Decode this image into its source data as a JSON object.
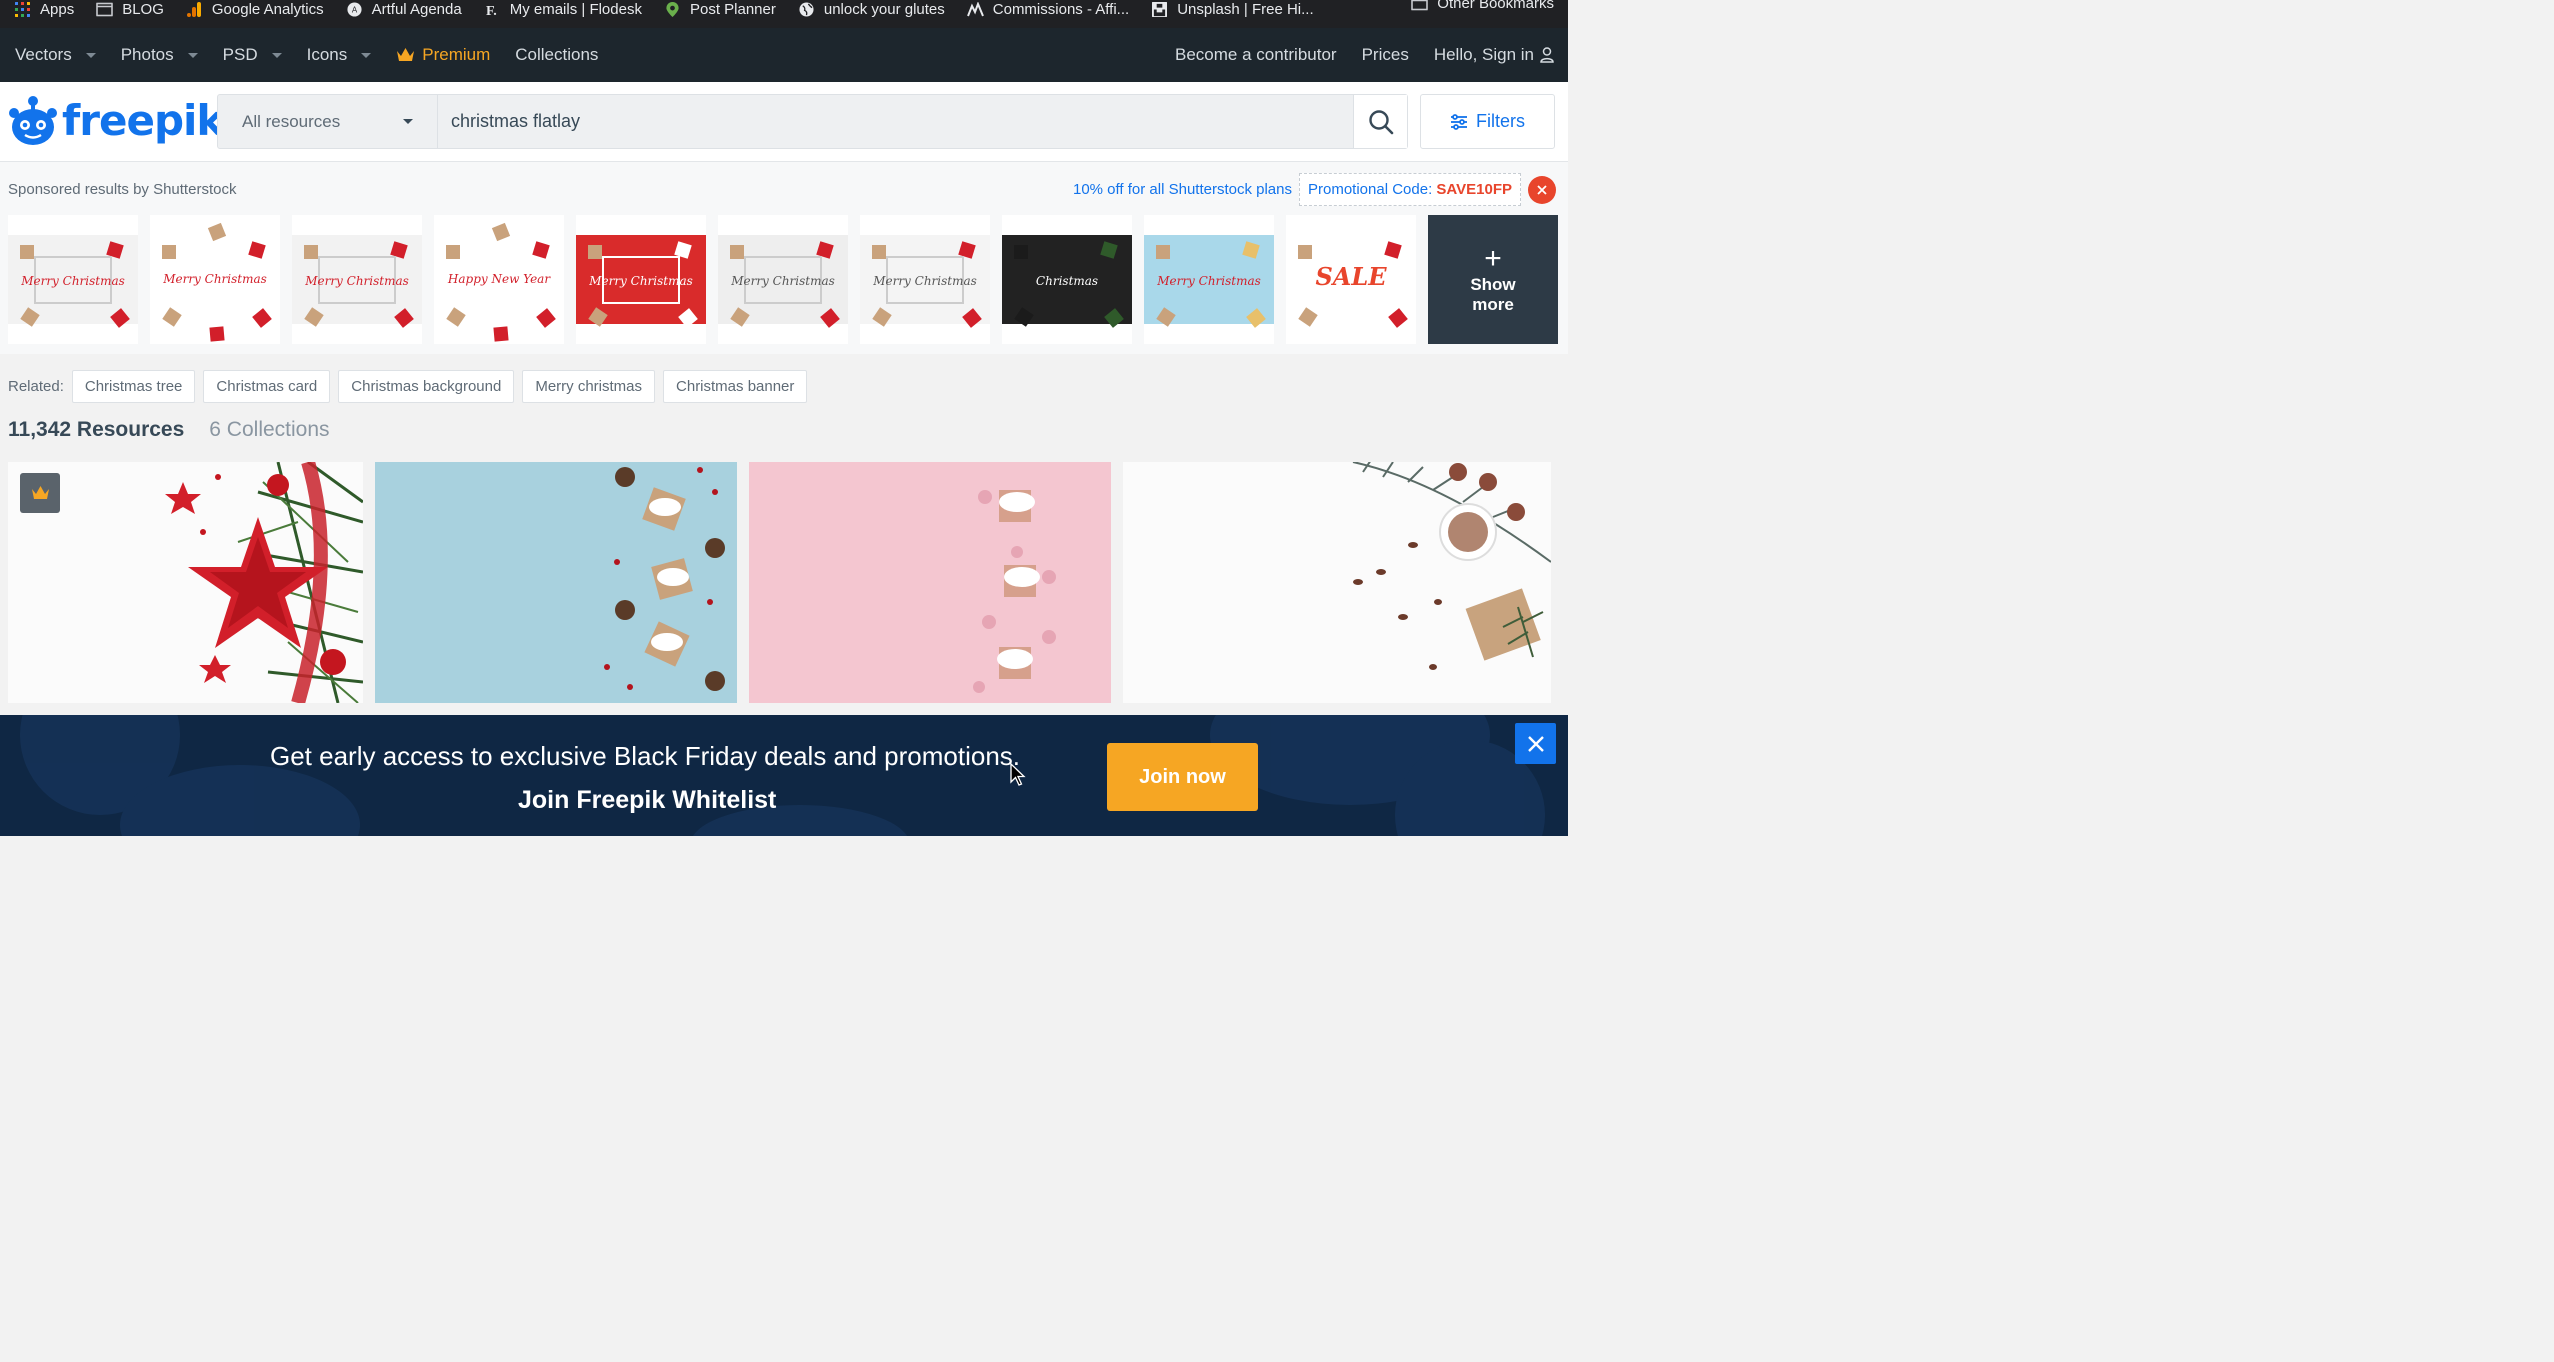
{
  "bookmarks": {
    "items": [
      {
        "label": "Apps",
        "icon": "apps-grid-icon",
        "color": "#4285f4"
      },
      {
        "label": "BLOG",
        "icon": "folder-icon",
        "color": "#c8cacf"
      },
      {
        "label": "Google Analytics",
        "icon": "analytics-icon",
        "color": "#f9ab00"
      },
      {
        "label": "Artful Agenda",
        "icon": "artful-agenda-icon",
        "color": "#e8eaed"
      },
      {
        "label": "My emails | Flodesk",
        "icon": "flodesk-icon",
        "color": "#1d1d1d"
      },
      {
        "label": "Post Planner",
        "icon": "post-planner-icon",
        "color": "#6ab04c"
      },
      {
        "label": "unlock your glutes",
        "icon": "globe-icon",
        "color": "#e8eaed"
      },
      {
        "label": "Commissions - Affi...",
        "icon": "commissions-icon",
        "color": "#1d1d1d"
      },
      {
        "label": "Unsplash | Free Hi...",
        "icon": "unsplash-icon",
        "color": "#e8eaed"
      }
    ],
    "other": "Other Bookmarks"
  },
  "nav": {
    "items": [
      {
        "label": "Vectors",
        "dropdown": true
      },
      {
        "label": "Photos",
        "dropdown": true
      },
      {
        "label": "PSD",
        "dropdown": true
      },
      {
        "label": "Icons",
        "dropdown": true
      }
    ],
    "premium": "Premium",
    "collections": "Collections",
    "contributor": "Become a contributor",
    "prices": "Prices",
    "signin": "Hello, Sign in"
  },
  "logo": {
    "text": "freepik",
    "color": "#1273eb"
  },
  "search": {
    "resource_type": "All resources",
    "query": "christmas flatlay",
    "filters_label": "Filters"
  },
  "sponsored": {
    "label": "Sponsored results by Shutterstock",
    "plans_text": "10% off for all Shutterstock plans",
    "promo_prefix": "Promotional Code:",
    "promo_code": "SAVE10FP",
    "show_more": "Show more",
    "thumbs": [
      {
        "name": "merry-christmas-frame-gifts",
        "bg": "#f2f2f2",
        "text": "Merry Christmas"
      },
      {
        "name": "merry-christmas-lettering-gifts",
        "bg": "#ffffff",
        "text": "Merry Christmas"
      },
      {
        "name": "merry-christmas-frame-gifts-2",
        "bg": "#f2f2f2",
        "text": "Merry Christmas"
      },
      {
        "name": "happy-new-year-gifts",
        "bg": "#ffffff",
        "text": "Happy New Year"
      },
      {
        "name": "red-christmas-frame",
        "bg": "#d92b2b",
        "text": "Merry Christmas"
      },
      {
        "name": "silver-christmas-frame",
        "bg": "#eeeeee",
        "text": "Merry Christmas"
      },
      {
        "name": "gold-snowflakes-frame",
        "bg": "#f4f4f4",
        "text": "Merry Christmas"
      },
      {
        "name": "dark-fir-christmas",
        "bg": "#222222",
        "text": "Christmas"
      },
      {
        "name": "pastel-christmas-gifts",
        "bg": "#a9d8ea",
        "text": "Merry Christmas"
      },
      {
        "name": "christmas-sale-banner",
        "bg": "#ffffff",
        "text": "SALE"
      }
    ]
  },
  "related": {
    "label": "Related:",
    "tags": [
      "Christmas tree",
      "Christmas card",
      "Christmas background",
      "Merry christmas",
      "Christmas banner"
    ]
  },
  "results": {
    "resources": "11,342 Resources",
    "collections": "6 Collections"
  },
  "banner": {
    "line1": "Get early access to exclusive Black Friday deals and promotions.",
    "line2": "Join Freepik Whitelist",
    "button": "Join now"
  },
  "colors": {
    "brand_blue": "#1273eb",
    "premium_orange": "#f6a623",
    "promo_red": "#e8452c",
    "nav_bg": "#1d262d",
    "banner_bg": "#0f2744"
  }
}
